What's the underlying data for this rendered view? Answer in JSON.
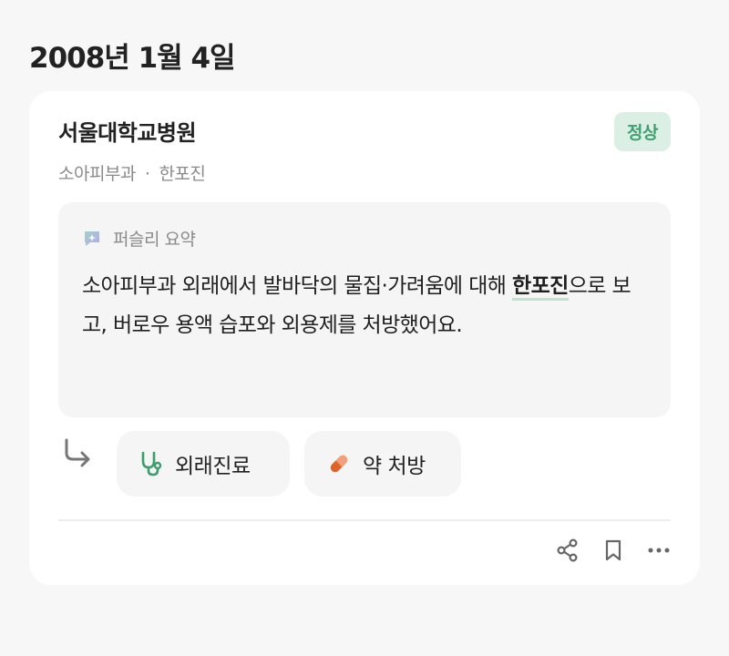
{
  "date": "2008년 1월 4일",
  "record": {
    "hospital": "서울대학교병원",
    "status": "정상",
    "department": "소아피부과",
    "separator": "·",
    "diagnosis": "한포진",
    "summary": {
      "title": "퍼슬리 요약",
      "text_before": "소아피부과 외래에서 발바닥의 물집·가려움에 대해 ",
      "highlight": "한포진",
      "text_after": "으로 보고, 버로우 용액 습포와 외용제를 처방했어요."
    },
    "tags": [
      {
        "label": "외래진료",
        "icon": "stethoscope-icon",
        "color": "#3a9e6d"
      },
      {
        "label": "약 처방",
        "icon": "pill-icon",
        "color": "#e0642a"
      }
    ],
    "actions": [
      "share-icon",
      "bookmark-icon",
      "more-icon"
    ]
  },
  "colors": {
    "badge_bg": "#dcefe5",
    "badge_text": "#3f9f6f",
    "highlight_underline": "#bfe3d0",
    "card_bg": "#ffffff",
    "page_bg": "#f7f7f8"
  }
}
